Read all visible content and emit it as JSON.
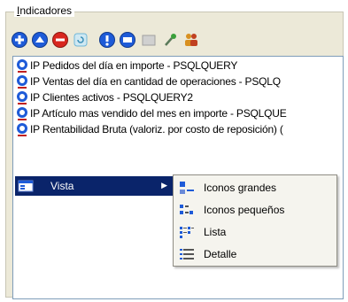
{
  "group": {
    "title_underlined": "I",
    "title_rest": "ndicadores"
  },
  "toolbar": {
    "buttons": [
      {
        "name": "add-icon",
        "color": "#1e5bd8"
      },
      {
        "name": "up-icon",
        "color": "#1e5bd8"
      },
      {
        "name": "remove-icon",
        "color": "#d8261e"
      },
      {
        "name": "refresh-icon",
        "color": "#6fb7d8"
      },
      {
        "name": "info-icon",
        "color": "#1e5bd8"
      },
      {
        "name": "options-icon",
        "color": "#1e5bd8"
      },
      {
        "name": "disabled-icon",
        "color": "#c0c0c0"
      },
      {
        "name": "key-icon",
        "color": "#3aa03a"
      },
      {
        "name": "users-icon",
        "color": "#d89020"
      }
    ]
  },
  "list": {
    "items": [
      {
        "label": "IP Pedidos del día en importe - PSQLQUERY"
      },
      {
        "label": "IP Ventas del día en cantidad de operaciones - PSQLQ"
      },
      {
        "label": "IP Clientes activos - PSQLQUERY2"
      },
      {
        "label": "IP Artículo mas vendido del mes en importe - PSQLQUE"
      },
      {
        "label": "IP Rentabilidad Bruta (valoriz. por costo de reposición) ("
      }
    ]
  },
  "context_menu": {
    "vista_label": "Vista"
  },
  "submenu": {
    "items": [
      {
        "label": "Iconos grandes",
        "icon": "large-icons-icon"
      },
      {
        "label": "Iconos pequeños",
        "icon": "small-icons-icon"
      },
      {
        "label": "Lista",
        "icon": "list-view-icon"
      },
      {
        "label": "Detalle",
        "icon": "details-view-icon"
      }
    ]
  },
  "colors": {
    "highlight": "#0a246a",
    "panel": "#ece9d8"
  }
}
